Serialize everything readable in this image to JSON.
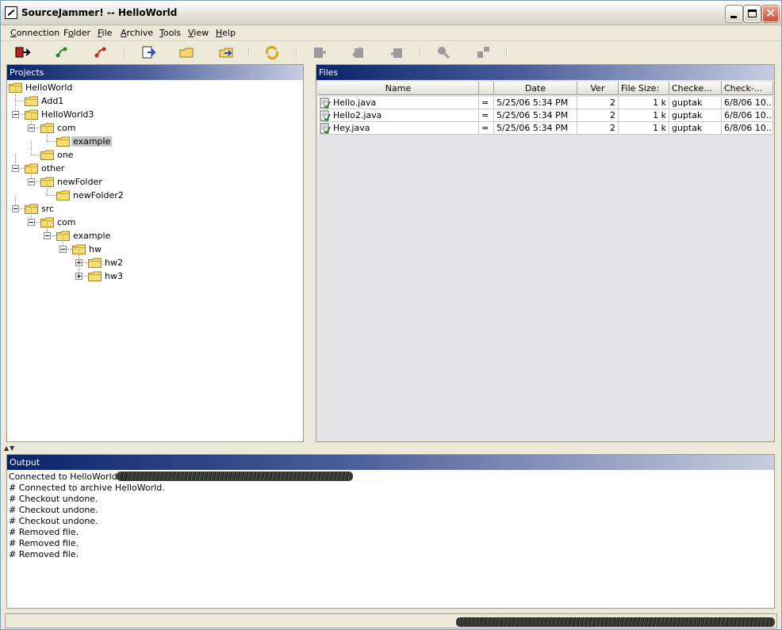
{
  "window": {
    "title": "SourceJammer! -- HelloWorld"
  },
  "menu": [
    {
      "pre": "",
      "key": "C",
      "post": "onnection"
    },
    {
      "pre": "F",
      "key": "o",
      "post": "lder"
    },
    {
      "pre": "",
      "key": "F",
      "post": "ile"
    },
    {
      "pre": "",
      "key": "A",
      "post": "rchive"
    },
    {
      "pre": "",
      "key": "T",
      "post": "ools"
    },
    {
      "pre": "",
      "key": "V",
      "post": "iew"
    },
    {
      "pre": "",
      "key": "H",
      "post": "elp"
    }
  ],
  "toolbar": {
    "icons": [
      "disconnect-icon",
      "connect-icon",
      "connect-remote-icon",
      "add-file-icon",
      "new-folder-icon",
      "move-folder-icon",
      "refresh-icon",
      "checkout-icon",
      "checkin-icon",
      "undo-checkout-icon",
      "search-icon",
      "remove-icon"
    ]
  },
  "projects": {
    "header": "Projects",
    "nodes": [
      {
        "label": "HelloWorld",
        "depth": 0,
        "expander": "none",
        "selected": false
      },
      {
        "label": "Add1",
        "depth": 1,
        "expander": "none",
        "selected": false
      },
      {
        "label": "HelloWorld3",
        "depth": 1,
        "expander": "minus",
        "selected": false
      },
      {
        "label": "com",
        "depth": 2,
        "expander": "minus",
        "selected": false
      },
      {
        "label": "example",
        "depth": 3,
        "expander": "none",
        "selected": true
      },
      {
        "label": "one",
        "depth": 2,
        "expander": "none",
        "selected": false
      },
      {
        "label": "other",
        "depth": 1,
        "expander": "minus",
        "selected": false
      },
      {
        "label": "newFolder",
        "depth": 2,
        "expander": "minus",
        "selected": false
      },
      {
        "label": "newFolder2",
        "depth": 3,
        "expander": "none",
        "selected": false
      },
      {
        "label": "src",
        "depth": 1,
        "expander": "minus",
        "selected": false
      },
      {
        "label": "com",
        "depth": 2,
        "expander": "minus",
        "selected": false
      },
      {
        "label": "example",
        "depth": 3,
        "expander": "minus",
        "selected": false
      },
      {
        "label": "hw",
        "depth": 4,
        "expander": "minus",
        "selected": false
      },
      {
        "label": "hw2",
        "depth": 5,
        "expander": "plus",
        "selected": false
      },
      {
        "label": "hw3",
        "depth": 5,
        "expander": "plus",
        "selected": false
      }
    ]
  },
  "files": {
    "header": "Files",
    "columns": [
      "Name",
      "",
      "Date",
      "Ver",
      "File Size:",
      "Checke...",
      "Check-..."
    ],
    "rows": [
      {
        "name": "Hello.java",
        "status": "=",
        "date": "5/25/06 5:34 PM",
        "ver": "2",
        "size": "1 k",
        "checked_by": "guptak",
        "checked_date": "6/8/06 10..."
      },
      {
        "name": "Hello2.java",
        "status": "=",
        "date": "5/25/06 5:34 PM",
        "ver": "2",
        "size": "1 k",
        "checked_by": "guptak",
        "checked_date": "6/8/06 10..."
      },
      {
        "name": "Hey.java",
        "status": "=",
        "date": "5/25/06 5:34 PM",
        "ver": "2",
        "size": "1 k",
        "checked_by": "guptak",
        "checked_date": "6/8/06 10..."
      }
    ]
  },
  "output": {
    "header": "Output",
    "lines": [
      "Connected to HelloWorld @",
      "# Connected to archive HelloWorld.",
      "# Checkout undone.",
      "# Checkout undone.",
      "# Checkout undone.",
      "# Removed file.",
      "# Removed file.",
      "# Removed file."
    ]
  },
  "colors": {
    "header_dark": "#0a246a",
    "selection": "#c8c8c8",
    "window_bg": "#ece9d8"
  }
}
